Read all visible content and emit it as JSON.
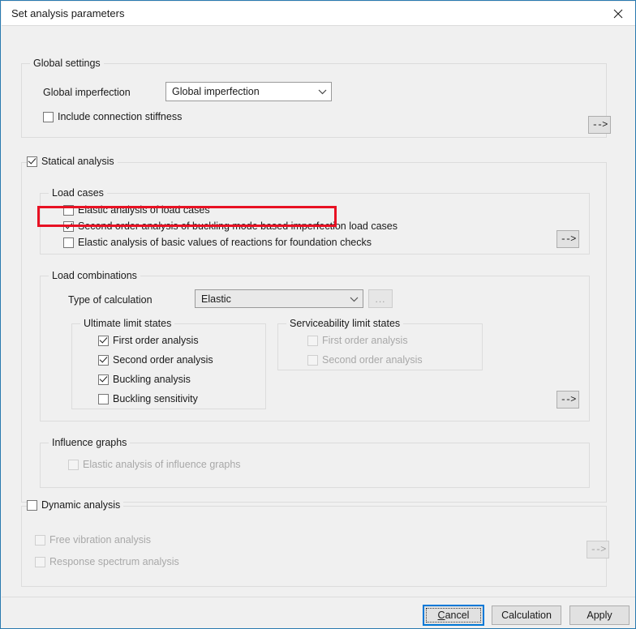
{
  "window": {
    "title": "Set analysis parameters",
    "close_icon": "close-icon"
  },
  "global_settings": {
    "title": "Global settings",
    "imperfection_label": "Global imperfection",
    "imperfection_value": "Global imperfection",
    "include_connection_stiffness": {
      "label": "Include connection stiffness",
      "checked": false,
      "enabled": true
    },
    "arrow_button": "-->"
  },
  "statical_analysis": {
    "label": "Statical analysis",
    "checked": true,
    "enabled": true,
    "load_cases": {
      "title": "Load cases",
      "items": [
        {
          "label": "Elastic analysis of load cases",
          "checked": false,
          "enabled": true
        },
        {
          "label": "Second order analysis of buckling mode based imperfection load cases",
          "checked": true,
          "enabled": true
        },
        {
          "label": "Elastic analysis of basic values of reactions for foundation checks",
          "checked": false,
          "enabled": true
        }
      ],
      "arrow_button": "-->"
    },
    "load_combinations": {
      "title": "Load combinations",
      "type_label": "Type of calculation",
      "type_value": "Elastic",
      "ellipsis_button": "...",
      "ultimate": {
        "title": "Ultimate limit states",
        "items": [
          {
            "label": "First order analysis",
            "checked": true,
            "enabled": true
          },
          {
            "label": "Second order analysis",
            "checked": true,
            "enabled": true
          },
          {
            "label": "Buckling analysis",
            "checked": true,
            "enabled": true
          },
          {
            "label": "Buckling sensitivity",
            "checked": false,
            "enabled": true
          }
        ]
      },
      "serviceability": {
        "title": "Serviceability limit states",
        "items": [
          {
            "label": "First order analysis",
            "checked": false,
            "enabled": false
          },
          {
            "label": "Second order analysis",
            "checked": false,
            "enabled": false
          }
        ]
      },
      "arrow_button": "-->"
    },
    "influence_graphs": {
      "title": "Influence graphs",
      "items": [
        {
          "label": "Elastic analysis of influence graphs",
          "checked": false,
          "enabled": false
        }
      ]
    }
  },
  "dynamic_analysis": {
    "label": "Dynamic analysis",
    "checked": false,
    "enabled": true,
    "items": [
      {
        "label": "Free vibration analysis",
        "checked": false,
        "enabled": false
      },
      {
        "label": "Response spectrum analysis",
        "checked": false,
        "enabled": false
      }
    ],
    "arrow_button": "-->"
  },
  "footer": {
    "cancel": "Cancel",
    "cancel_accel": "C",
    "calculation": "Calculation",
    "apply": "Apply"
  },
  "annotation": {
    "highlight_color": "#e81123",
    "highlight_target": "Second order analysis of buckling mode based imperfection load cases"
  }
}
